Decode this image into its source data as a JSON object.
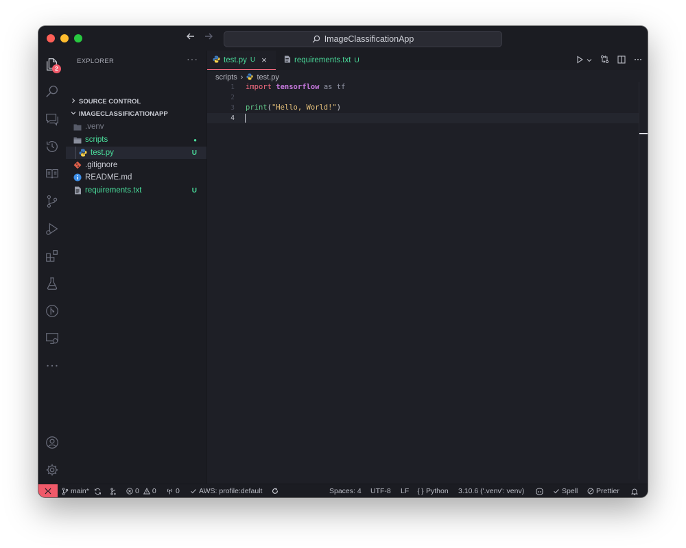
{
  "window": {
    "search_title": "ImageClassificationApp"
  },
  "activity": {
    "explorer_badge": "2"
  },
  "sidebar": {
    "title": "EXPLORER",
    "more": "···",
    "sections": [
      {
        "label": "SOURCE CONTROL",
        "expanded": false
      },
      {
        "label": "IMAGECLASSIFICATIONAPP",
        "expanded": true
      }
    ],
    "tree": [
      {
        "label": ".venv",
        "status": ""
      },
      {
        "label": "scripts",
        "status": "●"
      },
      {
        "label": "test.py",
        "status": "U"
      },
      {
        "label": ".gitignore",
        "status": ""
      },
      {
        "label": "README.md",
        "status": ""
      },
      {
        "label": "requirements.txt",
        "status": "U"
      }
    ]
  },
  "editor": {
    "tabs": [
      {
        "label": "test.py",
        "status": "U",
        "close": "×"
      },
      {
        "label": "requirements.txt",
        "status": "U"
      }
    ],
    "breadcrumb": {
      "folder": "scripts",
      "separator": "›",
      "file": "test.py"
    },
    "lines": [
      {
        "n": "1",
        "tokens": [
          "import",
          " ",
          "tensorflow",
          " ",
          "as",
          " ",
          "tf"
        ]
      },
      {
        "n": "2",
        "tokens": []
      },
      {
        "n": "3",
        "tokens": [
          "print",
          "(",
          "\"Hello, World!\"",
          ")"
        ]
      },
      {
        "n": "4",
        "tokens": []
      }
    ]
  },
  "statusbar": {
    "branch": "main*",
    "errors": "0",
    "warnings": "0",
    "ports": "0",
    "aws": "AWS: profile:default",
    "spaces": "Spaces: 4",
    "encoding": "UTF-8",
    "eol": "LF",
    "language": "Python",
    "interpreter": "3.10.6 ('.venv': venv)",
    "spell": "Spell",
    "prettier": "Prettier"
  },
  "colors": {
    "accent": "#f36b7f",
    "untracked": "#4ade9c",
    "remote": "#f05a6a",
    "background": "#1e1f26"
  }
}
